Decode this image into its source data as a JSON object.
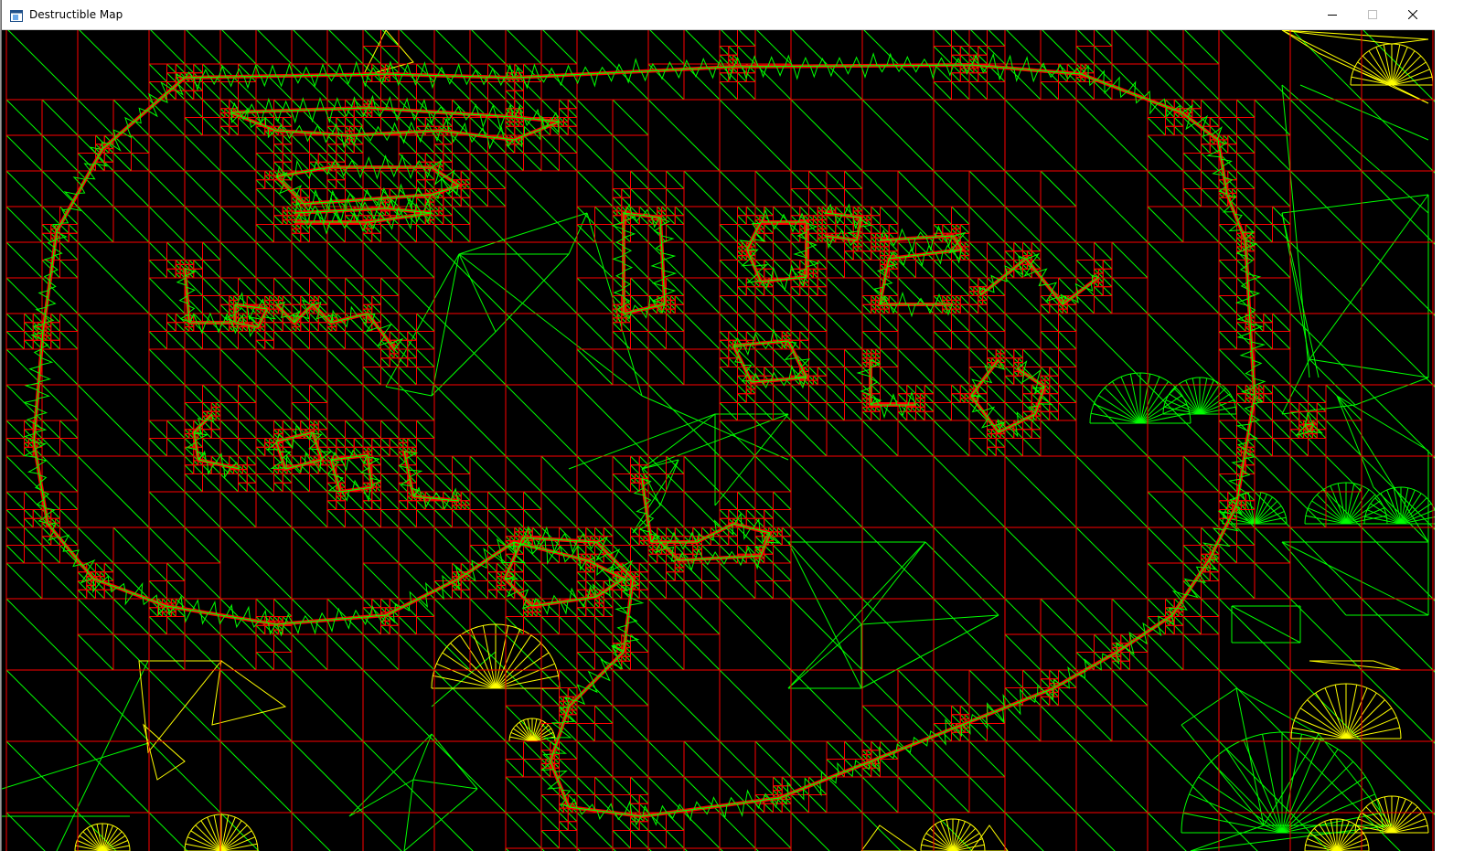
{
  "window": {
    "title": "Destructible Map",
    "controls": {
      "minimize_icon": "minimize-icon",
      "maximize_icon": "maximize-icon",
      "close_icon": "close-icon"
    }
  },
  "colors": {
    "background": "#000000",
    "quadtree_grid": "#ff0000",
    "triangulation_mesh": "#00ff00",
    "secondary_mesh": "#ffff00",
    "titlebar": "#ffffff"
  },
  "map": {
    "description_icons": [
      "map-canvas"
    ]
  }
}
